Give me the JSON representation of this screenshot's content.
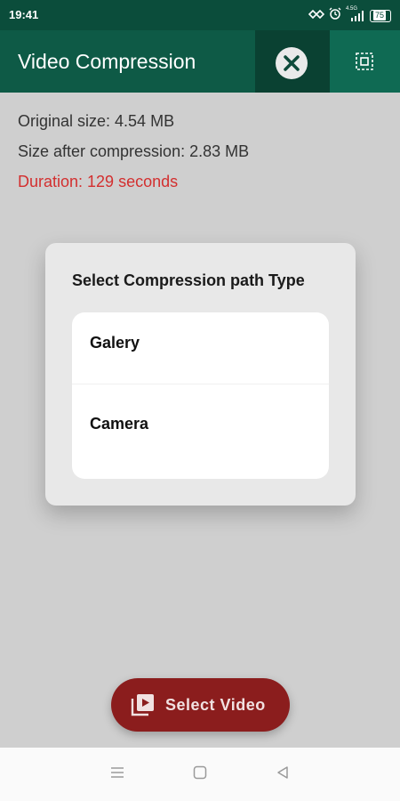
{
  "status": {
    "time": "19:41",
    "network": "4.5G",
    "battery": "75"
  },
  "app_bar": {
    "title": "Video Compression"
  },
  "info": {
    "original_size": "Original size: 4.54 MB",
    "compressed_size": "Size after compression: 2.83 MB",
    "duration": "Duration: 129 seconds"
  },
  "dialog": {
    "title": "Select Compression path Type",
    "options": [
      {
        "label": "Galery"
      },
      {
        "label": "Camera"
      }
    ]
  },
  "fab": {
    "label": "Select Video"
  },
  "colors": {
    "app_bar": "#0e5a46",
    "fab": "#8b1d1d",
    "duration_text": "#d32f2f"
  }
}
